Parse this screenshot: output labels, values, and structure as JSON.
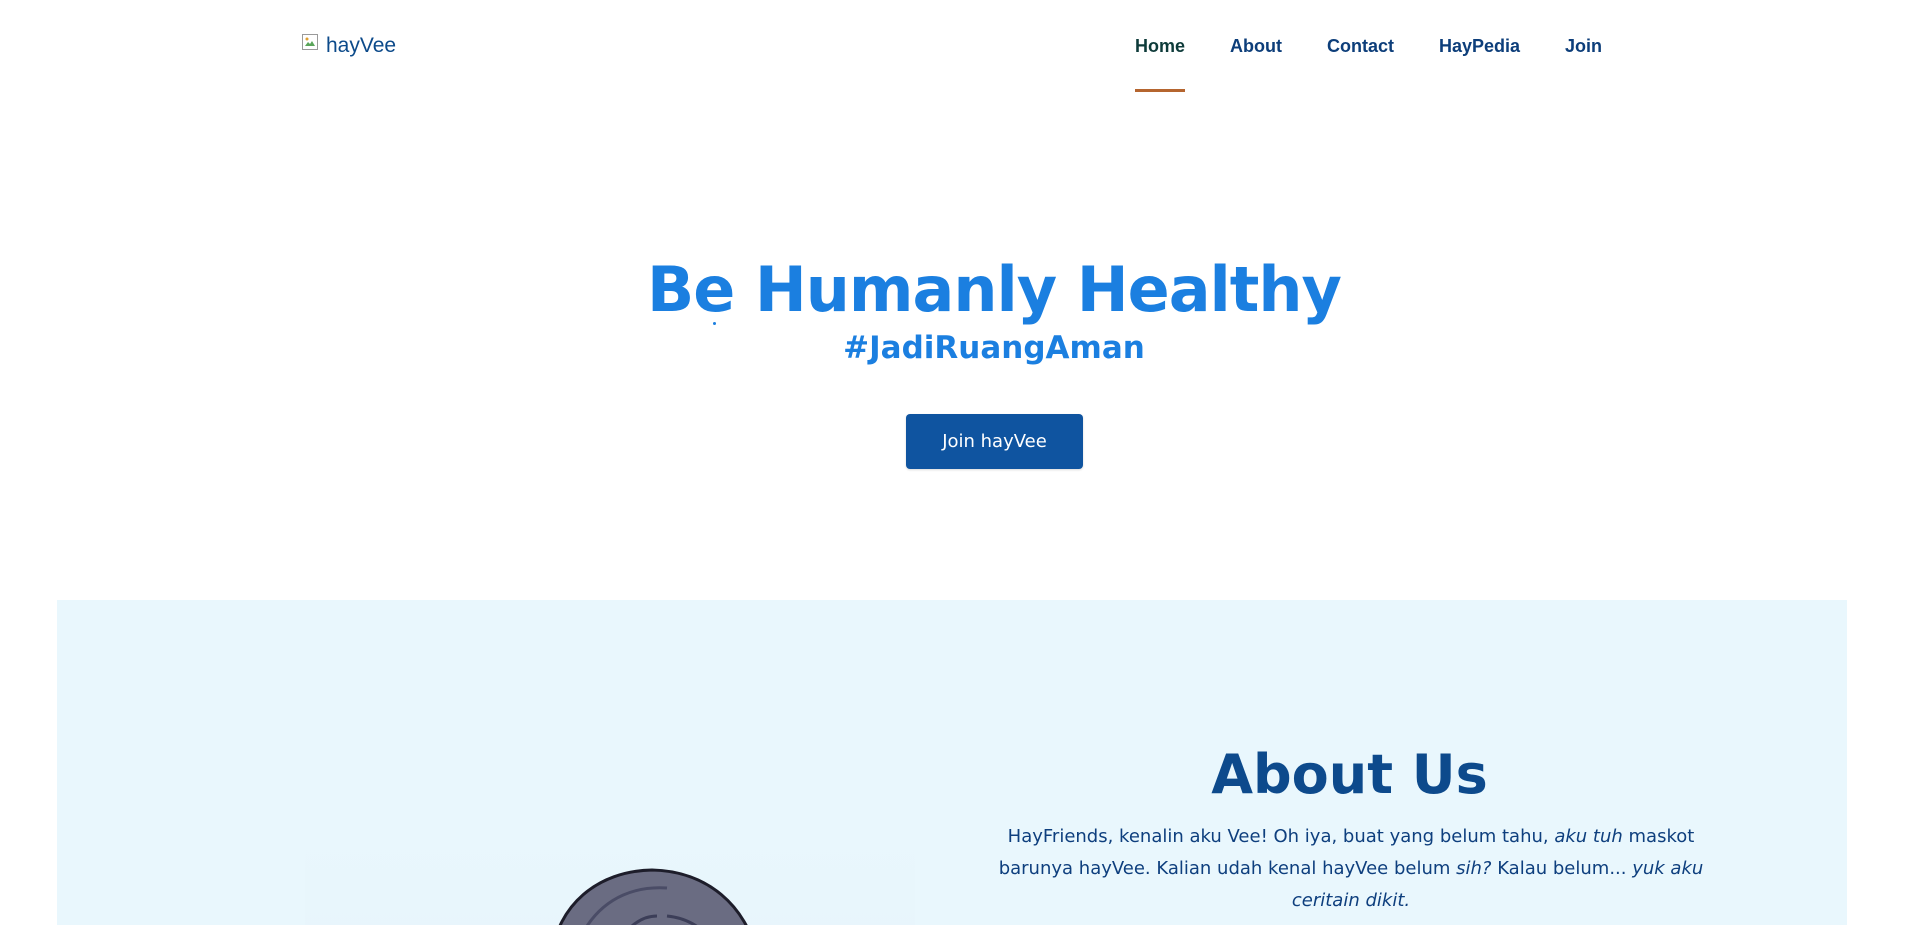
{
  "header": {
    "logo_alt": "hayVee",
    "nav": [
      {
        "label": "Home",
        "active": true
      },
      {
        "label": "About",
        "active": false
      },
      {
        "label": "Contact",
        "active": false
      },
      {
        "label": "HayPedia",
        "active": false
      },
      {
        "label": "Join",
        "active": false
      }
    ]
  },
  "hero": {
    "title": "Be Humanly Healthy",
    "subtitle": "#JadiRuangAman",
    "cta_label": "Join hayVee"
  },
  "about": {
    "title": "About Us",
    "paragraph": [
      {
        "text": "HayFriends, kenalin aku Vee! Oh iya, buat yang belum tahu, ",
        "italic": false
      },
      {
        "text": "aku tuh",
        "italic": true
      },
      {
        "text": " maskot barunya hayVee. Kalian udah kenal hayVee belum ",
        "italic": false
      },
      {
        "text": "sih?",
        "italic": true
      },
      {
        "text": " Kalau belum... ",
        "italic": false
      },
      {
        "text": "yuk aku ceritain dikit.",
        "italic": true
      }
    ]
  },
  "colors": {
    "primary_blue": "#1b7fe0",
    "button_blue": "#0f54a0",
    "nav_text": "#0d3e7a",
    "active_underline": "#b5652f",
    "about_background": "#e9f7fd"
  },
  "icons": {
    "logo": "broken-image-icon",
    "mascot": "mascot-vee-image"
  }
}
